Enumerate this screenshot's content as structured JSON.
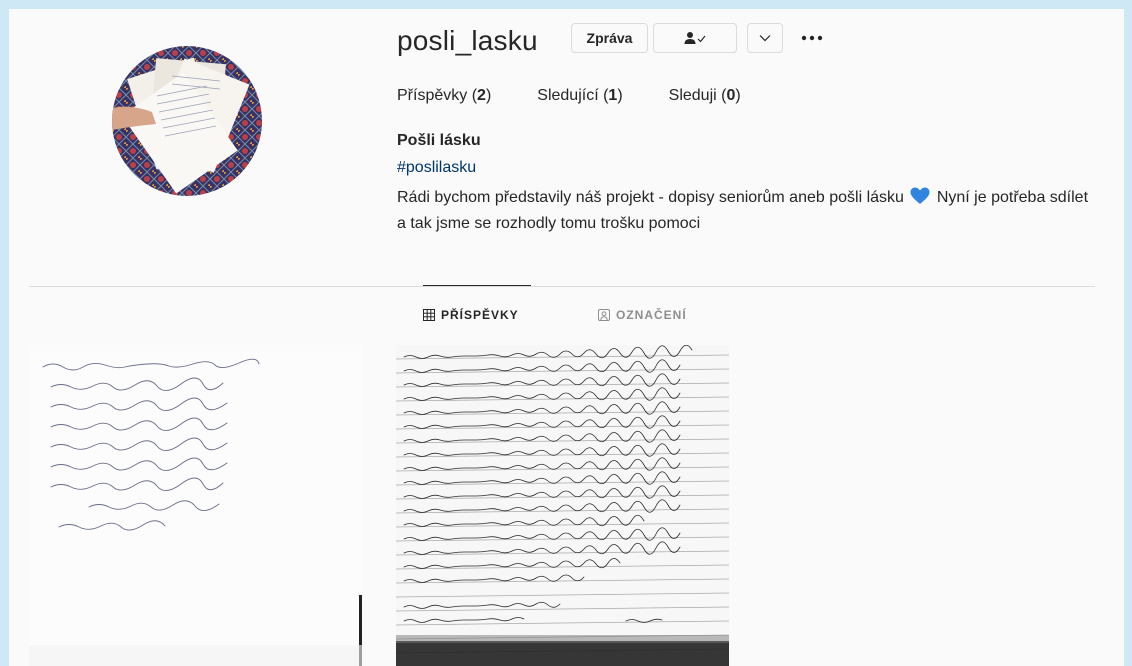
{
  "profile": {
    "username": "posli_lasku",
    "message_label": "Zpráva",
    "stats": {
      "posts_label": "Příspěvky",
      "posts_count": "2",
      "followers_label": "Sledující",
      "followers_count": "1",
      "following_label": "Sleduji",
      "following_count": "0"
    },
    "bio": {
      "name": "Pošli lásku",
      "hashtag": "#poslilasku",
      "text_before_emoji": "Rádi bychom představily náš projekt - dopisy seniorům aneb pošli lásku",
      "text_after_emoji": "Nyní je potřeba sdílet a tak jsme se rozhodly tomu trošku pomoci"
    }
  },
  "tabs": [
    {
      "label": "PŘÍSPĚVKY",
      "icon": "grid-icon",
      "active": true
    },
    {
      "label": "OZNAČENÍ",
      "icon": "tagged-icon",
      "active": false
    }
  ],
  "icons": {
    "follow": "person-check-icon",
    "suggest": "chevron-down-icon",
    "more": "ellipsis-icon",
    "emoji": "blue-heart-icon"
  },
  "colors": {
    "hashtag": "#00376b",
    "heart": "#2f84e0",
    "border": "#dbdbdb",
    "background": "#fafafa",
    "outer": "#cfe8f6"
  }
}
